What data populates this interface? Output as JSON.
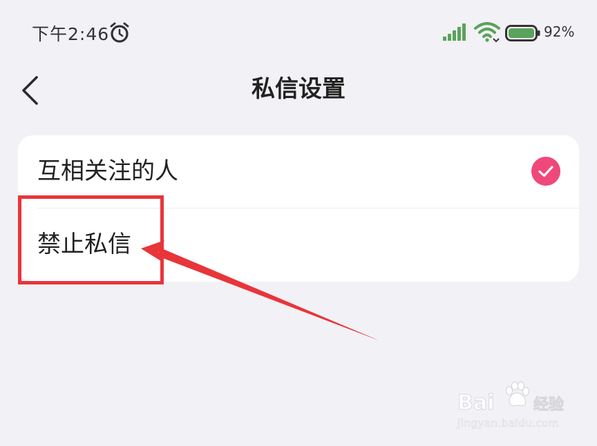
{
  "status_bar": {
    "time": "下午2:46",
    "battery_percent": "92%",
    "icons": [
      "alarm-icon",
      "signal-icon",
      "wifi-icon",
      "battery-icon"
    ]
  },
  "header": {
    "title": "私信设置",
    "back_icon": "chevron-left-icon"
  },
  "options": [
    {
      "label": "互相关注的人",
      "selected": true
    },
    {
      "label": "禁止私信",
      "selected": false
    }
  ],
  "colors": {
    "background": "#f2f1f6",
    "card": "#ffffff",
    "accent_check": "#f0487b",
    "annotation_red": "#e8353a",
    "status_green": "#5aa35c"
  },
  "watermark": {
    "brand": "Bai",
    "label": "经验",
    "domain": "jingyan.baidu.com"
  }
}
